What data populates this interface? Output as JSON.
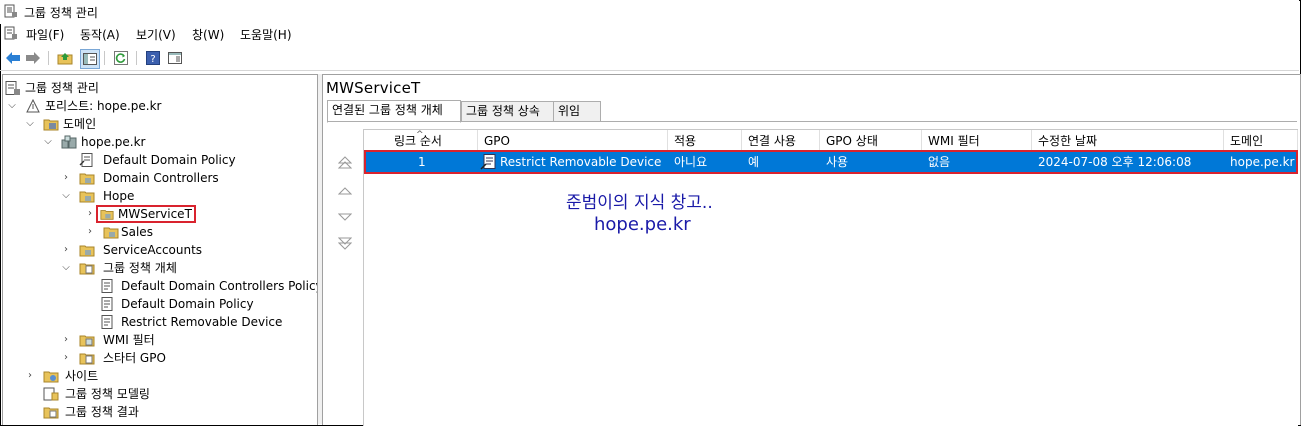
{
  "window": {
    "title": "그룹 정책 관리"
  },
  "menu": {
    "items": [
      "파일(F)",
      "동작(A)",
      "보기(V)",
      "창(W)",
      "도움말(H)"
    ]
  },
  "toolbar": {
    "buttons": [
      "back-icon",
      "forward-icon",
      "up-folder-icon",
      "show-hide-tree-icon",
      "refresh-icon",
      "help-icon",
      "properties-icon"
    ]
  },
  "tree": {
    "root": "그룹 정책 관리",
    "forest": "포리스트: hope.pe.kr",
    "domains": "도메인",
    "domain": "hope.pe.kr",
    "default_domain_policy": "Default Domain Policy",
    "domain_controllers": "Domain Controllers",
    "hope": "Hope",
    "mwservicet": "MWServiceT",
    "sales": "Sales",
    "service_accounts": "ServiceAccounts",
    "gpo_container": "그룹 정책 개체",
    "gpo_items": [
      "Default Domain Controllers Policy",
      "Default Domain Policy",
      "Restrict Removable Device"
    ],
    "wmi_filters": "WMI 필터",
    "starter_gpo": "스타터 GPO",
    "sites": "사이트",
    "modeling": "그룹 정책 모델링",
    "results": "그룹 정책 결과"
  },
  "detail": {
    "title": "MWServiceT",
    "tabs": [
      "연결된 그룹 정책 개체",
      "그룹 정책 상속",
      "위임"
    ],
    "columns": [
      "링크 순서",
      "GPO",
      "적용",
      "연결 사용",
      "GPO 상태",
      "WMI 필터",
      "수정한 날짜",
      "도메인"
    ],
    "rows": [
      {
        "order": "1",
        "gpo": "Restrict Removable Device",
        "enforced": "아니요",
        "link_enabled": "예",
        "gpo_status": "사용",
        "wmi_filter": "없음",
        "modified": "2024-07-08 오후 12:06:08",
        "domain": "hope.pe.kr"
      }
    ]
  },
  "watermark": {
    "line1": "준범이의 지식 창고..",
    "line2": "hope.pe.kr"
  },
  "colors": {
    "selection": "#0078d7",
    "highlight_border": "#d9232e",
    "watermark": "#1a1aa8"
  }
}
